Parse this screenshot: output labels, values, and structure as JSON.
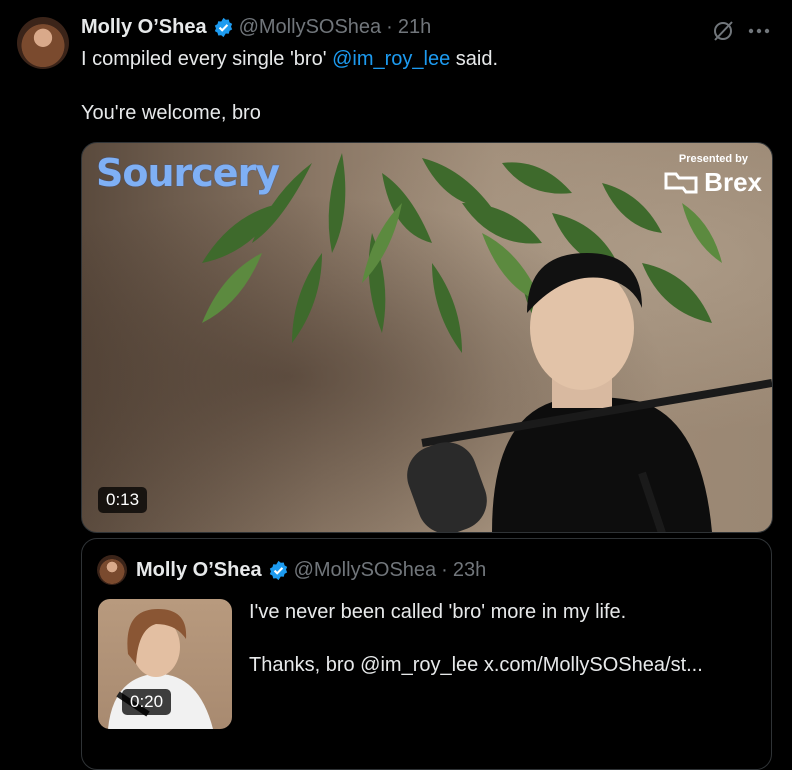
{
  "tweet": {
    "author_name": "Molly O’Shea",
    "handle": "@MollySOShea",
    "separator": "·",
    "time": "21h",
    "text_before_mention": "I compiled every single 'bro' ",
    "mention": "@im_roy_lee",
    "text_after_mention": " said.",
    "line2": "You're welcome, bro",
    "icons": {
      "verified": "verified-badge-icon",
      "grok": "grok-icon",
      "more": "more-icon"
    }
  },
  "video": {
    "brand_left": "Sourcery",
    "presented_by": "Presented by",
    "sponsor": "Brex",
    "duration": "0:13"
  },
  "quoted": {
    "author_name": "Molly O’Shea",
    "handle": "@MollySOShea",
    "separator": "·",
    "time": "23h",
    "line1": "I've never been called 'bro' more in my life.",
    "line2": "Thanks, bro @im_roy_lee  x.com/MollySOShea/st...",
    "duration": "0:20"
  },
  "colors": {
    "background": "#000000",
    "text": "#e7e9ea",
    "muted": "#71767b",
    "link": "#1d9bf0",
    "verified": "#1d9bf0"
  }
}
